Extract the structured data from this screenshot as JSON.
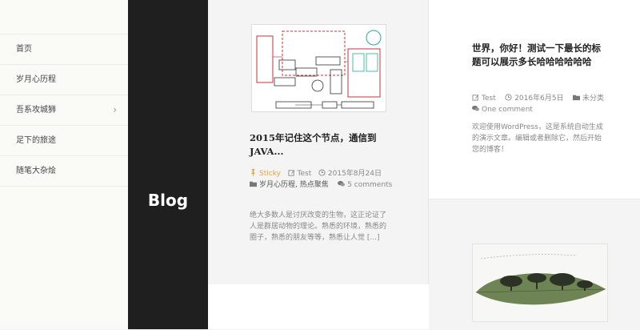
{
  "nav": {
    "items": [
      {
        "label": "首页"
      },
      {
        "label": "岁月心历程"
      },
      {
        "label": "吾系攻城狮"
      },
      {
        "label": "足下的旅途"
      },
      {
        "label": "随笔大杂烩"
      }
    ],
    "submenu_icon": "chevron-right-icon"
  },
  "brand": {
    "text": "Blog"
  },
  "post1": {
    "title": "2015年记住这个节点，通信到JAVA...",
    "sticky_label": "Sticky",
    "author": "Test",
    "date": "2015年8月24日",
    "categories": "岁月心历程, 热点聚焦",
    "comments": "5 comments",
    "excerpt": "绝大多数人是讨厌改变的生物，这正论证了人是群居动物的理论。熟悉的环境，熟悉的圈子，熟悉的朋友等等，熟悉让人觉 [...]"
  },
  "post2": {
    "title": "世界，你好！测试一下最长的标题可以展示多长哈哈哈哈哈哈",
    "author": "Test",
    "date": "2016年6月5日",
    "category": "未分类",
    "comments": "One comment",
    "excerpt": "欢迎使用WordPress，这是系统自动生成的演示文章。编辑或者删除它，然后开始您的博客！"
  },
  "colors": {
    "accent": "#e8a23a",
    "sidebar_dark": "#1f1f1f"
  }
}
